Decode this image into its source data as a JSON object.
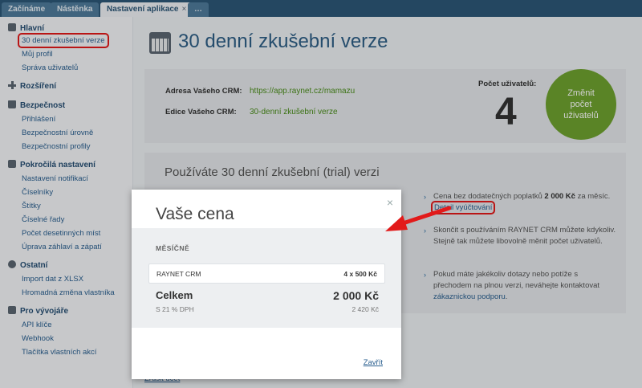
{
  "tabs": [
    {
      "label": "Začínáme"
    },
    {
      "label": "Nástěnka"
    },
    {
      "label": "Nastavení aplikace",
      "close": "×"
    },
    {
      "label": "…"
    }
  ],
  "sidebar": {
    "main": {
      "label": "Hlavní",
      "items": [
        "30 denní zkušební verze",
        "Můj profil",
        "Správa uživatelů"
      ]
    },
    "ext": {
      "label": "Rozšíření"
    },
    "sec": {
      "label": "Bezpečnost",
      "items": [
        "Přihlášení",
        "Bezpečnostní úrovně",
        "Bezpečnostní profily"
      ]
    },
    "adv": {
      "label": "Pokročilá nastavení",
      "items": [
        "Nastavení notifikací",
        "Číselníky",
        "Štítky",
        "Číselné řady",
        "Počet desetinných míst",
        "Úprava záhlaví a zápatí"
      ]
    },
    "other": {
      "label": "Ostatní",
      "items": [
        "Import dat z XLSX",
        "Hromadná změna vlastníka"
      ]
    },
    "dev": {
      "label": "Pro vývojáře",
      "items": [
        "API klíče",
        "Webhook",
        "Tlačítka vlastních akcí"
      ]
    }
  },
  "page": {
    "title": "30 denní zkušební verze",
    "address_label": "Adresa Vašeho CRM:",
    "address_value": "https://app.raynet.cz/mamazu",
    "edition_label": "Edice Vašeho CRM:",
    "edition_value": "30-denní zkušební verze",
    "users_label": "Počet uživatelů:",
    "users_count": "4",
    "change_users_button": "Změnit počet uživatelů",
    "trial_title": "Používáte 30 denní zkušební (trial) verzi",
    "info1_pre": "Cena bez dodatečných poplatků",
    "info1_bold": "2 000 Kč",
    "info1_mid": "za měsíc.",
    "info1_link": "Detail vyúčtování",
    "info2": "Skončit s používáním RAYNET CRM můžete kdykoliv. Stejně tak můžete libovolně měnit počet uživatelů.",
    "info3_pre": "Pokud máte jakékoliv dotazy nebo potíže s přechodem na plnou verzi, neváhejte kontaktovat",
    "info3_link": "zákaznickou podporu",
    "info3_post": ".",
    "bottom_link": "Zrušit účet"
  },
  "modal": {
    "title": "Vaše cena",
    "close_icon": "×",
    "frequency": "MĚSÍČNĚ",
    "line_name": "RAYNET CRM",
    "line_price": "4 x 500 Kč",
    "total_label": "Celkem",
    "total_value": "2 000 Kč",
    "vat_label": "S 21 % DPH",
    "vat_value": "2 420 Kč",
    "close_link": "Zavřít"
  },
  "colors": {
    "accent": "#2e5e85",
    "green": "#6ea12f",
    "highlight": "#e21a1a"
  }
}
